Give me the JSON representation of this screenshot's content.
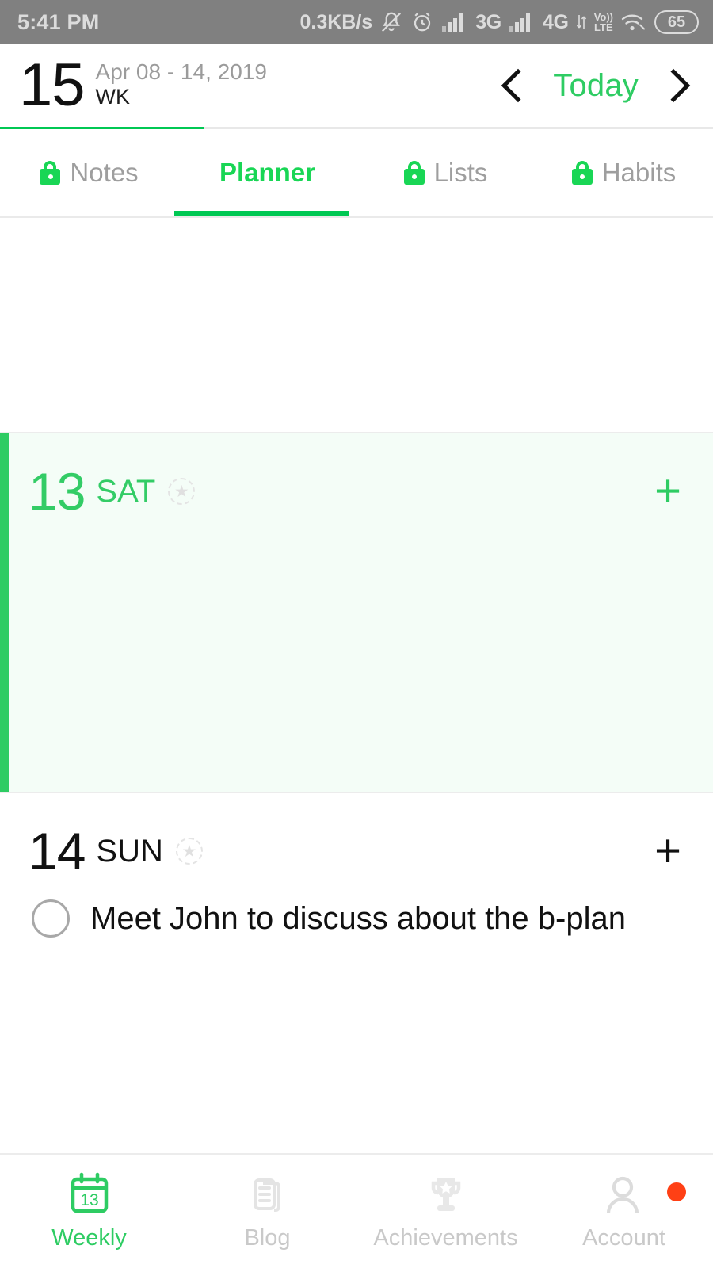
{
  "status_bar": {
    "time": "5:41 PM",
    "network_speed": "0.3KB/s",
    "icons": [
      "silent-bell-icon",
      "alarm-clock-icon",
      "signal-bars-icon",
      "signal-bars-icon",
      "wifi-icon"
    ],
    "sim1_label": "3G",
    "sim2_label": "4G",
    "volte_top": "Vo))",
    "volte_bottom": "LTE",
    "battery_level": "65"
  },
  "header": {
    "week_number": "15",
    "date_range": "Apr 08 - 14, 2019",
    "week_suffix": "WK",
    "prev_label": "‹",
    "today_label": "Today",
    "next_label": "›"
  },
  "tabs": [
    {
      "label": "Notes",
      "locked": true,
      "active": false
    },
    {
      "label": "Planner",
      "locked": false,
      "active": true
    },
    {
      "label": "Lists",
      "locked": true,
      "active": false
    },
    {
      "label": "Habits",
      "locked": true,
      "active": false
    }
  ],
  "days": [
    {
      "number": "13",
      "dow": "SAT",
      "is_today": true,
      "star": "★",
      "add_label": "+",
      "tasks": []
    },
    {
      "number": "14",
      "dow": "SUN",
      "is_today": false,
      "star": "★",
      "add_label": "+",
      "tasks": [
        {
          "text": "Meet John to discuss about the b-plan",
          "done": false
        }
      ]
    }
  ],
  "bottom_nav": [
    {
      "label": "Weekly",
      "icon": "calendar-icon",
      "icon_text": "13",
      "active": true,
      "badge": false
    },
    {
      "label": "Blog",
      "icon": "document-icon",
      "active": false,
      "badge": false
    },
    {
      "label": "Achievements",
      "icon": "trophy-icon",
      "active": false,
      "badge": false
    },
    {
      "label": "Account",
      "icon": "person-icon",
      "active": false,
      "badge": true
    }
  ],
  "colors": {
    "accent_green": "#2ecc63",
    "bright_green": "#19d655",
    "bar_green": "#00c853",
    "today_bg": "#f4fdf7",
    "muted_grey": "#9e9e9e",
    "badge_red": "#ff4015",
    "status_bar_bg": "#808080"
  }
}
